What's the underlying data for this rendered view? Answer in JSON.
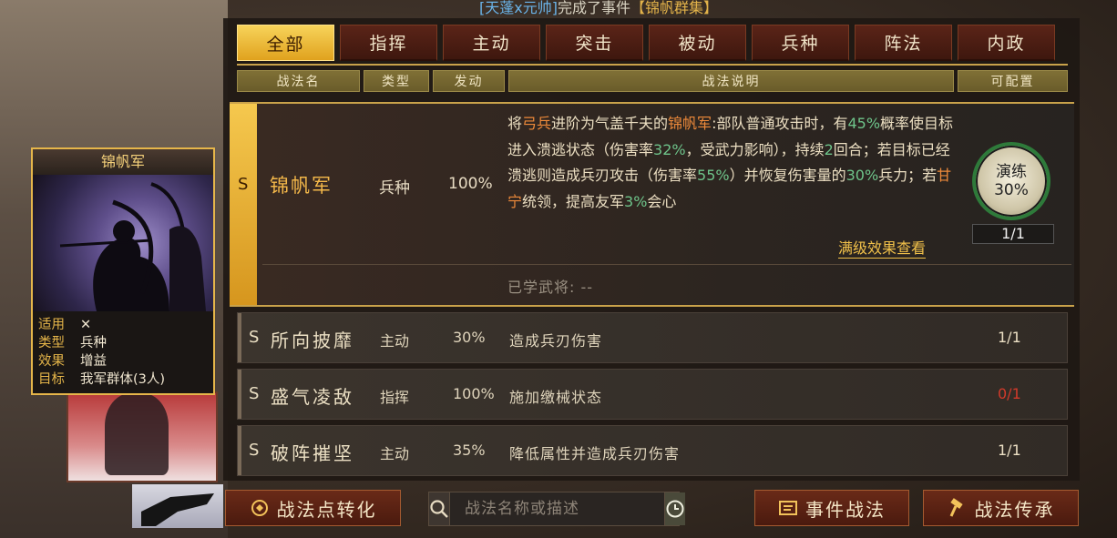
{
  "notification": {
    "prefix": "[天蓬x元帅]",
    "middle": "完成了事件",
    "event": "【锦帆群集】"
  },
  "tabs": [
    {
      "label": "全部",
      "active": true
    },
    {
      "label": "指挥",
      "active": false
    },
    {
      "label": "主动",
      "active": false
    },
    {
      "label": "突击",
      "active": false
    },
    {
      "label": "被动",
      "active": false
    },
    {
      "label": "兵种",
      "active": false
    },
    {
      "label": "阵法",
      "active": false
    },
    {
      "label": "内政",
      "active": false
    }
  ],
  "columns": {
    "name": "战法名",
    "type": "类型",
    "trigger": "发动",
    "desc": "战法说明",
    "config": "可配置"
  },
  "expanded": {
    "grade": "S",
    "name": "锦帆军",
    "type": "兵种",
    "rate": "100%",
    "desc_parts": [
      {
        "t": "将",
        "c": ""
      },
      {
        "t": "弓兵",
        "c": "o"
      },
      {
        "t": "进阶为气盖千夫的",
        "c": ""
      },
      {
        "t": "锦帆军",
        "c": "o"
      },
      {
        "t": ":部队普通攻击时，有",
        "c": ""
      },
      {
        "t": "45%",
        "c": "g"
      },
      {
        "t": "概率使目标进入溃逃状态（伤害率",
        "c": ""
      },
      {
        "t": "32%",
        "c": "g"
      },
      {
        "t": "，受武力影响），持续",
        "c": ""
      },
      {
        "t": "2",
        "c": "g"
      },
      {
        "t": "回合；若目标已经溃逃则造成兵刃攻击（伤害率",
        "c": ""
      },
      {
        "t": "55%",
        "c": "g"
      },
      {
        "t": "）并恢复伤害量的",
        "c": ""
      },
      {
        "t": "30%",
        "c": "g"
      },
      {
        "t": "兵力；若",
        "c": ""
      },
      {
        "t": "甘宁",
        "c": "o"
      },
      {
        "t": "统领，提高友军",
        "c": ""
      },
      {
        "t": "3%",
        "c": "g"
      },
      {
        "t": "会心",
        "c": ""
      }
    ],
    "max_link": "满级效果查看",
    "learned": "已学武将: --",
    "drill_label": "演练",
    "drill_value": "30%",
    "drill_count": "1/1"
  },
  "rows": [
    {
      "grade": "S",
      "name": "所向披靡",
      "type": "主动",
      "rate": "30%",
      "desc": "造成兵刃伤害",
      "count": "1/1",
      "count_red": false
    },
    {
      "grade": "S",
      "name": "盛气凌敌",
      "type": "指挥",
      "rate": "100%",
      "desc": "施加缴械状态",
      "count": "0/1",
      "count_red": true
    },
    {
      "grade": "S",
      "name": "破阵摧坚",
      "type": "主动",
      "rate": "35%",
      "desc": "降低属性并造成兵刃伤害",
      "count": "1/1",
      "count_red": false
    }
  ],
  "bottom": {
    "convert_label": "战法点转化",
    "search_placeholder": "战法名称或描述",
    "event_label": "事件战法",
    "inherit_label": "战法传承"
  },
  "card": {
    "title": "锦帆军",
    "k_apply": "适用",
    "v_apply": "✕",
    "k_type": "类型",
    "v_type": "兵种",
    "k_effect": "效果",
    "v_effect": "增益",
    "k_target": "目标",
    "v_target": "我军群体(3人)"
  },
  "colors": {
    "gold": "#e3b34a",
    "active_tab": "#f2c03a",
    "green_value": "#6ec48a",
    "orange_value": "#ee8a3a",
    "red_count": "#d23a2a"
  }
}
